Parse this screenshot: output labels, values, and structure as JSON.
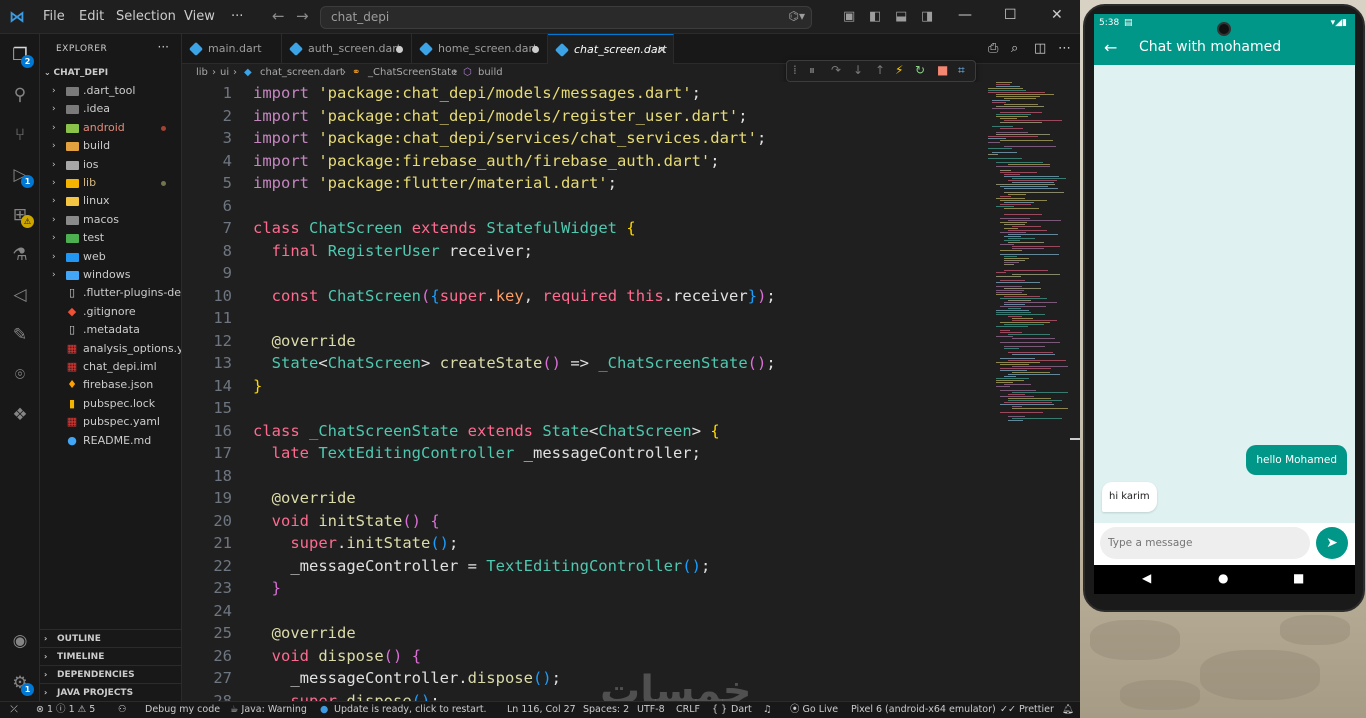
{
  "titlebar": {
    "menus": [
      "File",
      "Edit",
      "Selection",
      "View",
      "···"
    ],
    "search": "chat_depi"
  },
  "activity": {
    "explorer_badge": "2",
    "debug_badge": "1",
    "ext_badge": "⚠",
    "settings_badge": "1"
  },
  "sidebar": {
    "header": "EXPLORER",
    "more": "···",
    "root": "CHAT_DEPI",
    "items": [
      {
        "name": ".dart_tool",
        "type": "folder",
        "color": "#7a7a7a",
        "dot": ""
      },
      {
        "name": ".idea",
        "type": "folder",
        "color": "#7a7a7a",
        "dot": ""
      },
      {
        "name": "android",
        "type": "folder",
        "color": "#8bc34a",
        "dot": "red",
        "text_color": "#e38b7a"
      },
      {
        "name": "build",
        "type": "folder",
        "color": "#e2a03f",
        "dot": ""
      },
      {
        "name": "ios",
        "type": "folder",
        "color": "#a7a7a7",
        "dot": ""
      },
      {
        "name": "lib",
        "type": "folder",
        "color": "#f4b400",
        "dot": "mod",
        "text_color": "#d7ba7d"
      },
      {
        "name": "linux",
        "type": "folder",
        "color": "#f4c542",
        "dot": ""
      },
      {
        "name": "macos",
        "type": "folder",
        "color": "#8a8a8a",
        "dot": ""
      },
      {
        "name": "test",
        "type": "folder",
        "color": "#4caf50",
        "dot": ""
      },
      {
        "name": "web",
        "type": "folder",
        "color": "#2196f3",
        "dot": ""
      },
      {
        "name": "windows",
        "type": "folder",
        "color": "#42a5f5",
        "dot": ""
      },
      {
        "name": ".flutter-plugins-de...",
        "type": "file",
        "icon": "▯",
        "color": "#cccccc",
        "dot": ""
      },
      {
        "name": ".gitignore",
        "type": "file",
        "icon": "◆",
        "color": "#f05033",
        "dot": ""
      },
      {
        "name": ".metadata",
        "type": "file",
        "icon": "▯",
        "color": "#cccccc",
        "dot": ""
      },
      {
        "name": "analysis_options.y...",
        "type": "file",
        "icon": "▦",
        "color": "#e53935",
        "dot": ""
      },
      {
        "name": "chat_depi.iml",
        "type": "file",
        "icon": "▦",
        "color": "#e53935",
        "dot": ""
      },
      {
        "name": "firebase.json",
        "type": "file",
        "icon": "♦",
        "color": "#ffa000",
        "dot": ""
      },
      {
        "name": "pubspec.lock",
        "type": "file",
        "icon": "▮",
        "color": "#f4b400",
        "dot": ""
      },
      {
        "name": "pubspec.yaml",
        "type": "file",
        "icon": "▦",
        "color": "#e53935",
        "dot": ""
      },
      {
        "name": "README.md",
        "type": "file",
        "icon": "●",
        "color": "#42a5f5",
        "dot": ""
      }
    ],
    "sections": [
      "OUTLINE",
      "TIMELINE",
      "DEPENDENCIES",
      "JAVA PROJECTS"
    ]
  },
  "tabs": [
    {
      "label": "main.dart",
      "state": "clean"
    },
    {
      "label": "auth_screen.dart",
      "state": "dirty"
    },
    {
      "label": "home_screen.dart",
      "state": "dirty"
    },
    {
      "label": "chat_screen.dart",
      "state": "active"
    }
  ],
  "breadcrumb": [
    "lib",
    "ui",
    "chat_screen.dart",
    "_ChatScreenState",
    "build"
  ],
  "code": {
    "l1_a": "import ",
    "l1_b": "'package:chat_depi/models/messages.dart'",
    "l1_c": ";",
    "l2_a": "import ",
    "l2_b": "'package:chat_depi/models/register_user.dart'",
    "l2_c": ";",
    "l3_a": "import ",
    "l3_b": "'package:chat_depi/services/chat_services.dart'",
    "l3_c": ";",
    "l4_a": "import ",
    "l4_b": "'package:firebase_auth/firebase_auth.dart'",
    "l4_c": ";",
    "l5_a": "import ",
    "l5_b": "'package:flutter/material.dart'",
    "l5_c": ";"
  },
  "status": {
    "errors": "1",
    "infos": "1",
    "warnings": "5",
    "debug": "Debug my code",
    "java": "Java: Warning",
    "update": "Update is ready, click to restart.",
    "position": "Ln 116, Col 27",
    "spaces": "Spaces: 2",
    "encoding": "UTF-8",
    "eol": "CRLF",
    "braces": "{ }",
    "language": "Dart",
    "golive": "Go Live",
    "device": "Pixel 6 (android-x64 emulator)",
    "prettier": "Prettier"
  },
  "watermark": "خمسات",
  "phone": {
    "time": "5:38",
    "title": "Chat with mohamed",
    "messages": [
      {
        "text": "hello Mohamed",
        "dir": "out"
      },
      {
        "text": "hi karim",
        "dir": "in"
      }
    ],
    "input_placeholder": "Type a message",
    "accent": "#009688"
  }
}
